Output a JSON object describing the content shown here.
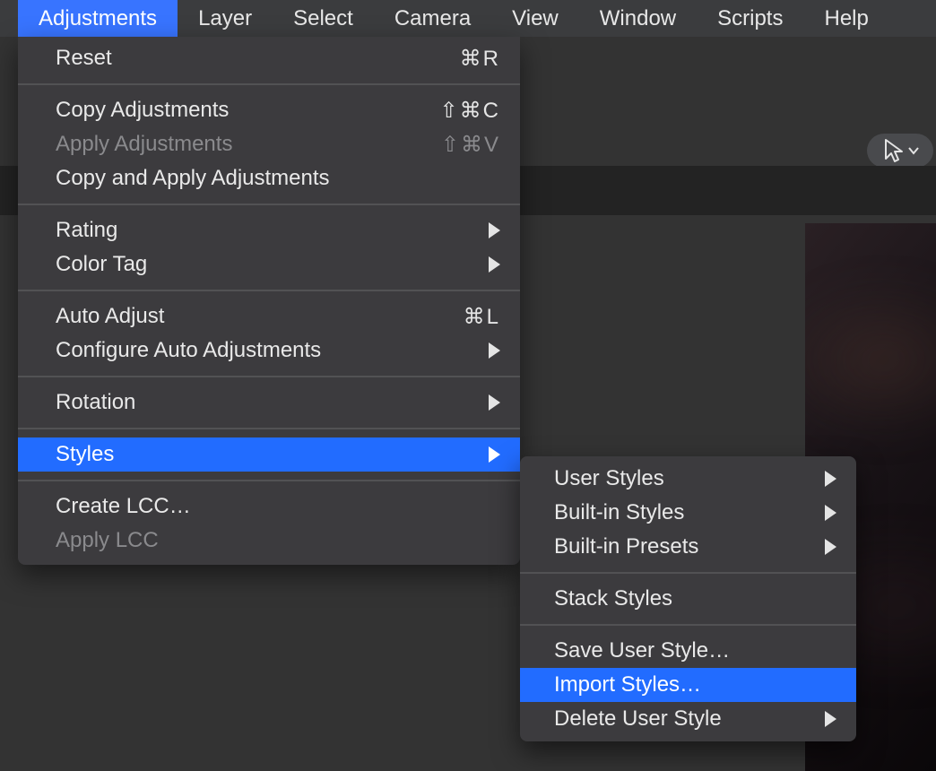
{
  "menubar": {
    "items": [
      {
        "label": "Adjustments",
        "active": true
      },
      {
        "label": "Layer"
      },
      {
        "label": "Select"
      },
      {
        "label": "Camera"
      },
      {
        "label": "View"
      },
      {
        "label": "Window"
      },
      {
        "label": "Scripts"
      },
      {
        "label": "Help"
      }
    ]
  },
  "menu": {
    "groups": [
      [
        {
          "label": "Reset",
          "shortcut": "⌘R"
        }
      ],
      [
        {
          "label": "Copy Adjustments",
          "shortcut": "⇧⌘C"
        },
        {
          "label": "Apply Adjustments",
          "shortcut": "⇧⌘V",
          "disabled": true
        },
        {
          "label": "Copy and Apply Adjustments"
        }
      ],
      [
        {
          "label": "Rating",
          "submenu": true
        },
        {
          "label": "Color Tag",
          "submenu": true
        }
      ],
      [
        {
          "label": "Auto Adjust",
          "shortcut": "⌘L"
        },
        {
          "label": "Configure Auto Adjustments",
          "submenu": true
        }
      ],
      [
        {
          "label": "Rotation",
          "submenu": true
        }
      ],
      [
        {
          "label": "Styles",
          "submenu": true,
          "selected": true
        }
      ],
      [
        {
          "label": "Create LCC…"
        },
        {
          "label": "Apply LCC",
          "disabled": true
        }
      ]
    ]
  },
  "submenu": {
    "groups": [
      [
        {
          "label": "User Styles",
          "submenu": true
        },
        {
          "label": "Built-in Styles",
          "submenu": true
        },
        {
          "label": "Built-in Presets",
          "submenu": true
        }
      ],
      [
        {
          "label": "Stack Styles"
        }
      ],
      [
        {
          "label": "Save User Style…"
        },
        {
          "label": "Import Styles…",
          "selected": true
        },
        {
          "label": "Delete User Style",
          "submenu": true
        }
      ]
    ]
  },
  "toolbar": {
    "cursor_tool": "pointer"
  }
}
